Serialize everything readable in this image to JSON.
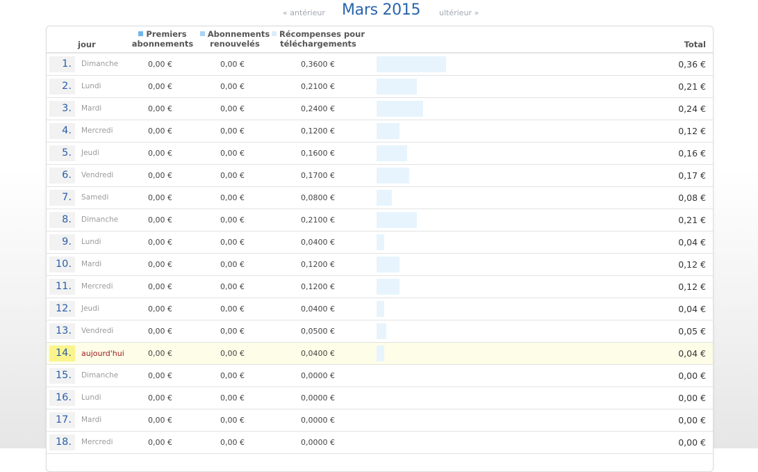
{
  "nav": {
    "prev_label": "« antérieur",
    "month_title": "Mars 2015",
    "next_label": "ultérieur »"
  },
  "columns": {
    "jour": "jour",
    "premiers_l1": "Premiers",
    "premiers_l2": "abonnements",
    "renouv_l1": "Abonnements",
    "renouv_l2": "renouvelés",
    "recomp_l1": "Récompenses pour",
    "recomp_l2": "téléchargements",
    "total": "Total"
  },
  "colors": {
    "premiers": "#6fb6ec",
    "renouveles": "#a9d3f2",
    "recompenses": "#dcecfa",
    "bar": "#e7f4fd",
    "accent": "#2a64aa"
  },
  "rows": [
    {
      "day": "1.",
      "name": "Dimanche",
      "premiers": "0,00 €",
      "renouveles": "0,00 €",
      "recompenses": "0,3600 €",
      "total": "0,36 €",
      "amount": 0.36
    },
    {
      "day": "2.",
      "name": "Lundi",
      "premiers": "0,00 €",
      "renouveles": "0,00 €",
      "recompenses": "0,2100 €",
      "total": "0,21 €",
      "amount": 0.21
    },
    {
      "day": "3.",
      "name": "Mardi",
      "premiers": "0,00 €",
      "renouveles": "0,00 €",
      "recompenses": "0,2400 €",
      "total": "0,24 €",
      "amount": 0.24
    },
    {
      "day": "4.",
      "name": "Mercredi",
      "premiers": "0,00 €",
      "renouveles": "0,00 €",
      "recompenses": "0,1200 €",
      "total": "0,12 €",
      "amount": 0.12
    },
    {
      "day": "5.",
      "name": "Jeudi",
      "premiers": "0,00 €",
      "renouveles": "0,00 €",
      "recompenses": "0,1600 €",
      "total": "0,16 €",
      "amount": 0.16
    },
    {
      "day": "6.",
      "name": "Vendredi",
      "premiers": "0,00 €",
      "renouveles": "0,00 €",
      "recompenses": "0,1700 €",
      "total": "0,17 €",
      "amount": 0.17
    },
    {
      "day": "7.",
      "name": "Samedi",
      "premiers": "0,00 €",
      "renouveles": "0,00 €",
      "recompenses": "0,0800 €",
      "total": "0,08 €",
      "amount": 0.08
    },
    {
      "day": "8.",
      "name": "Dimanche",
      "premiers": "0,00 €",
      "renouveles": "0,00 €",
      "recompenses": "0,2100 €",
      "total": "0,21 €",
      "amount": 0.21
    },
    {
      "day": "9.",
      "name": "Lundi",
      "premiers": "0,00 €",
      "renouveles": "0,00 €",
      "recompenses": "0,0400 €",
      "total": "0,04 €",
      "amount": 0.04
    },
    {
      "day": "10.",
      "name": "Mardi",
      "premiers": "0,00 €",
      "renouveles": "0,00 €",
      "recompenses": "0,1200 €",
      "total": "0,12 €",
      "amount": 0.12
    },
    {
      "day": "11.",
      "name": "Mercredi",
      "premiers": "0,00 €",
      "renouveles": "0,00 €",
      "recompenses": "0,1200 €",
      "total": "0,12 €",
      "amount": 0.12
    },
    {
      "day": "12.",
      "name": "Jeudi",
      "premiers": "0,00 €",
      "renouveles": "0,00 €",
      "recompenses": "0,0400 €",
      "total": "0,04 €",
      "amount": 0.04
    },
    {
      "day": "13.",
      "name": "Vendredi",
      "premiers": "0,00 €",
      "renouveles": "0,00 €",
      "recompenses": "0,0500 €",
      "total": "0,05 €",
      "amount": 0.05
    },
    {
      "day": "14.",
      "name": "aujourd'hui",
      "premiers": "0,00 €",
      "renouveles": "0,00 €",
      "recompenses": "0,0400 €",
      "total": "0,04 €",
      "amount": 0.04,
      "today": true
    },
    {
      "day": "15.",
      "name": "Dimanche",
      "premiers": "0,00 €",
      "renouveles": "0,00 €",
      "recompenses": "0,0000 €",
      "total": "0,00 €",
      "amount": 0
    },
    {
      "day": "16.",
      "name": "Lundi",
      "premiers": "0,00 €",
      "renouveles": "0,00 €",
      "recompenses": "0,0000 €",
      "total": "0,00 €",
      "amount": 0
    },
    {
      "day": "17.",
      "name": "Mardi",
      "premiers": "0,00 €",
      "renouveles": "0,00 €",
      "recompenses": "0,0000 €",
      "total": "0,00 €",
      "amount": 0
    },
    {
      "day": "18.",
      "name": "Mercredi",
      "premiers": "0,00 €",
      "renouveles": "0,00 €",
      "recompenses": "0,0000 €",
      "total": "0,00 €",
      "amount": 0
    }
  ]
}
